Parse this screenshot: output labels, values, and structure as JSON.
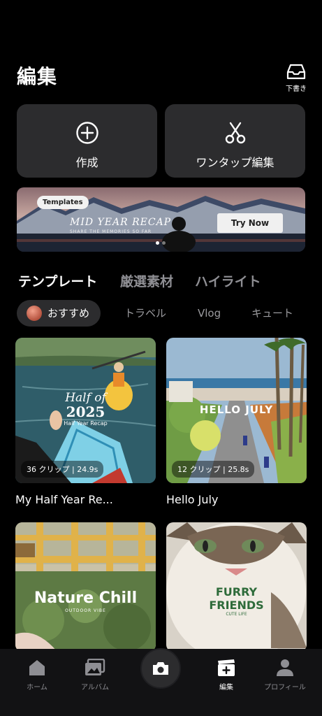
{
  "header": {
    "title": "編集",
    "drafts_label": "下書き",
    "drafts_icon": "inbox-tray-icon"
  },
  "actions": {
    "create_label": "作成",
    "create_icon": "plus-circle-icon",
    "onetap_label": "ワンタップ編集",
    "onetap_icon": "scissors-icon"
  },
  "banner": {
    "tag": "Templates",
    "title": "MID YEAR RECAP",
    "subtitle": "SHARE THE MEMORIES SO FAR",
    "button": "Try Now",
    "active_dot": 0,
    "dot_count": 2
  },
  "tabs": [
    {
      "label": "テンプレート",
      "active": true
    },
    {
      "label": "厳選素材",
      "active": false
    },
    {
      "label": "ハイライト",
      "active": false
    }
  ],
  "chips": [
    {
      "label": "おすすめ",
      "active": true
    },
    {
      "label": "トラベル",
      "active": false
    },
    {
      "label": "Vlog",
      "active": false
    },
    {
      "label": "キュート",
      "active": false
    }
  ],
  "cards": [
    {
      "title": "My Half Year Re...",
      "badge": "36 クリップ | 24.9s",
      "overlay_line1": "Half of",
      "overlay_line2": "2025",
      "overlay_line3": "Half Year Recap"
    },
    {
      "title": "Hello July",
      "badge": "12 クリップ | 25.8s",
      "overlay_line1": "HELLO JULY"
    },
    {
      "title": "",
      "badge": "",
      "overlay_line1": "Nature Chill",
      "overlay_line2": "OUTDOOR VIBE"
    },
    {
      "title": "",
      "badge": "",
      "overlay_line1": "FURRY",
      "overlay_line2": "FRIENDS",
      "overlay_line3": "CUTE LIFE"
    }
  ],
  "bottom_nav": [
    {
      "label": "ホーム",
      "icon": "home-icon",
      "active": false
    },
    {
      "label": "アルバム",
      "icon": "album-icon",
      "active": false
    },
    {
      "label": "",
      "icon": "camera-icon",
      "active": false
    },
    {
      "label": "編集",
      "icon": "clapper-plus-icon",
      "active": true
    },
    {
      "label": "プロフィール",
      "icon": "person-icon",
      "active": false
    }
  ],
  "colors": {
    "background": "#000000",
    "card": "#2c2c2e",
    "inactive_text": "#8e8e93",
    "nav_bg": "#121214"
  }
}
